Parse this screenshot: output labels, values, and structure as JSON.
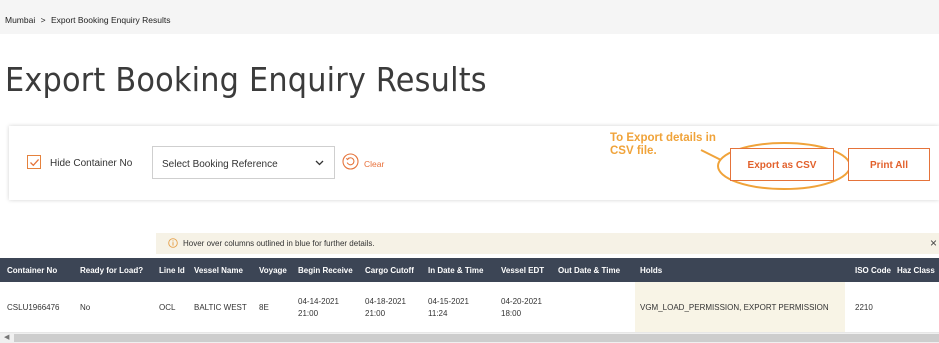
{
  "breadcrumb": {
    "home": "Mumbai",
    "separator": ">",
    "current": "Export Booking Enquiry Results"
  },
  "page": {
    "title": "Export Booking Enquiry Results"
  },
  "filters": {
    "hide_container_label": "Hide Container No",
    "hide_container_checked": true,
    "booking_select_value": "Select Booking Reference",
    "clear_label": "Clear",
    "export_note_line1": "To Export details in",
    "export_note_line2": "CSV file.",
    "export_csv_label": "Export as CSV",
    "print_all_label": "Print All"
  },
  "info": {
    "text": "Hover over columns outlined in blue for further details.",
    "close": "×"
  },
  "table": {
    "headers": [
      "Container No",
      "Ready for Load?",
      "Line Id",
      "Vessel Name",
      "Voyage",
      "Begin Receive",
      "Cargo Cutoff",
      "In Date & Time",
      "Vessel EDT",
      "Out Date & Time",
      "Holds",
      "ISO Code",
      "Haz Class"
    ],
    "rows": [
      {
        "container_no": "CSLU1966476",
        "ready_for_load": "No",
        "line_id": "OCL",
        "vessel_name": "BALTIC WEST",
        "voyage": "8E",
        "begin_receive_date": "04-14-2021",
        "begin_receive_time": "21:00",
        "cargo_cutoff_date": "04-18-2021",
        "cargo_cutoff_time": "21:00",
        "in_date": "04-15-2021",
        "in_time": "11:24",
        "vessel_edt_date": "04-20-2021",
        "vessel_edt_time": "18:00",
        "out_date_time": "",
        "holds": "VGM_LOAD_PERMISSION, EXPORT PERMISSION",
        "iso_code": "2210",
        "haz_class": ""
      }
    ]
  },
  "colors": {
    "accent": "#e5733a",
    "annotation": "#f0a33a",
    "header_bg": "#3c4555",
    "info_bg": "#f6f2e6"
  },
  "icons": {
    "checkbox": "check-icon",
    "select": "chevron-down-icon",
    "clear": "reset-icon",
    "info": "info-icon",
    "close": "close-icon"
  }
}
